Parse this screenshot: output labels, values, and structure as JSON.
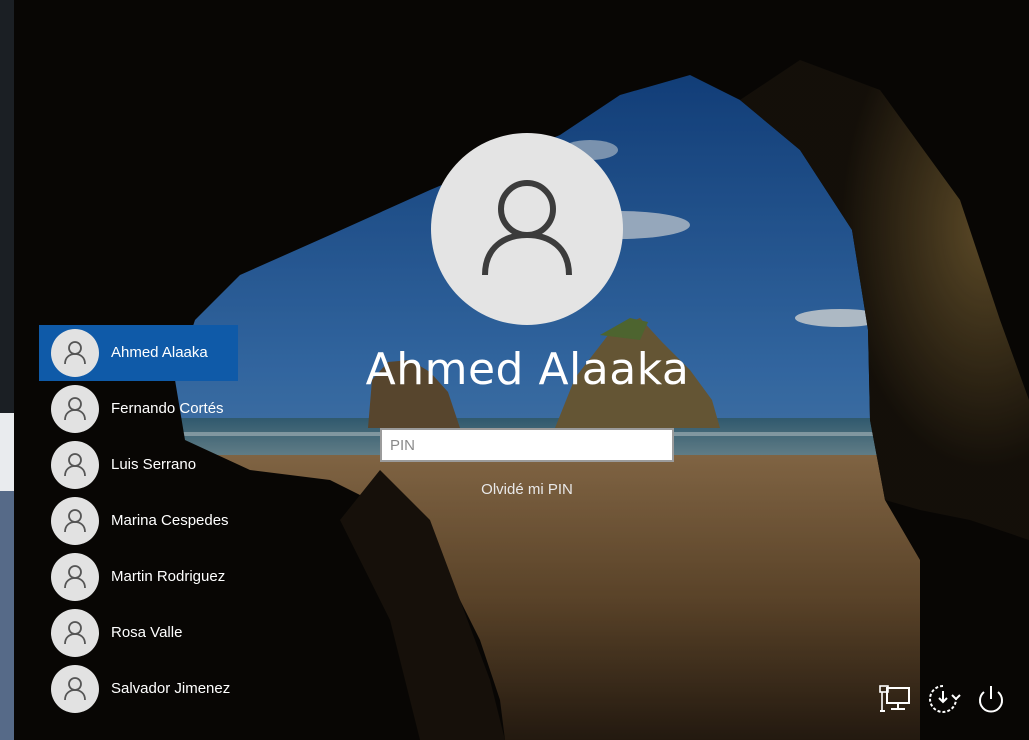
{
  "lock_screen": {
    "selected_user": "Ahmed Alaaka",
    "pin_placeholder": "PIN",
    "pin_value": "",
    "forgot_pin_label": "Olvidé mi PIN"
  },
  "users": [
    {
      "name": "Ahmed Alaaka",
      "selected": true
    },
    {
      "name": "Fernando Cortés",
      "selected": false
    },
    {
      "name": "Luis Serrano",
      "selected": false
    },
    {
      "name": "Marina Cespedes",
      "selected": false
    },
    {
      "name": "Martin Rodriguez",
      "selected": false
    },
    {
      "name": "Rosa Valle",
      "selected": false
    },
    {
      "name": "Salvador Jimenez",
      "selected": false
    }
  ],
  "system_icons": [
    "network-icon",
    "accessibility-icon",
    "power-icon"
  ],
  "colors": {
    "selection": "#0f5aa8",
    "avatar_bg": "#e4e4e4",
    "text": "#ffffff"
  }
}
